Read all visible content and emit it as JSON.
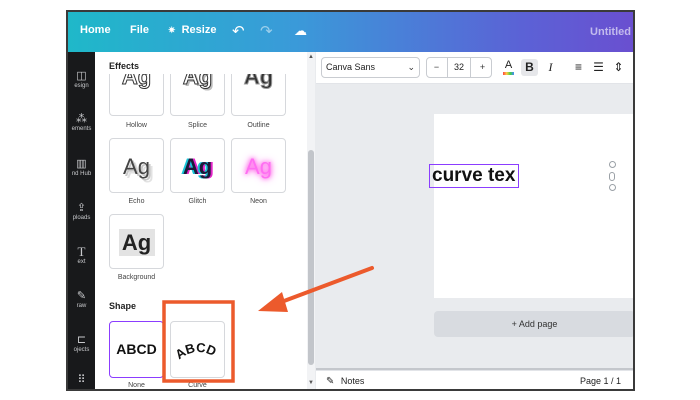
{
  "topbar": {
    "home_label": "Home",
    "file_label": "File",
    "resize_label": "Resize",
    "title": "Untitled"
  },
  "rail": {
    "items": [
      {
        "label": "esign"
      },
      {
        "label": "ements"
      },
      {
        "label": "nd Hub"
      },
      {
        "label": "ploads"
      },
      {
        "label": "ext"
      },
      {
        "label": "raw"
      },
      {
        "label": "ojects"
      }
    ]
  },
  "effects_panel": {
    "heading": "Effects",
    "sample_text": "Ag",
    "styles": [
      {
        "label": "Hollow"
      },
      {
        "label": "Splice"
      },
      {
        "label": "Outline"
      },
      {
        "label": "Echo"
      },
      {
        "label": "Glitch"
      },
      {
        "label": "Neon"
      },
      {
        "label": "Background"
      }
    ],
    "shape_heading": "Shape",
    "shape_sample": "ABCD",
    "shapes": [
      {
        "label": "None"
      },
      {
        "label": "Curve"
      }
    ]
  },
  "toolbar": {
    "font_name": "Canva Sans",
    "font_size": "32",
    "minus": "−",
    "plus": "+"
  },
  "canvas": {
    "text": "curve tex",
    "add_page_label": "+ Add page"
  },
  "bottombar": {
    "notes_label": "Notes",
    "page_indicator": "Page 1 / 1"
  },
  "colors": {
    "accent": "#8b3dff",
    "annotation": "#ec5a2c",
    "topbar_start": "#1fb8c9",
    "topbar_end": "#6a4fd0"
  }
}
